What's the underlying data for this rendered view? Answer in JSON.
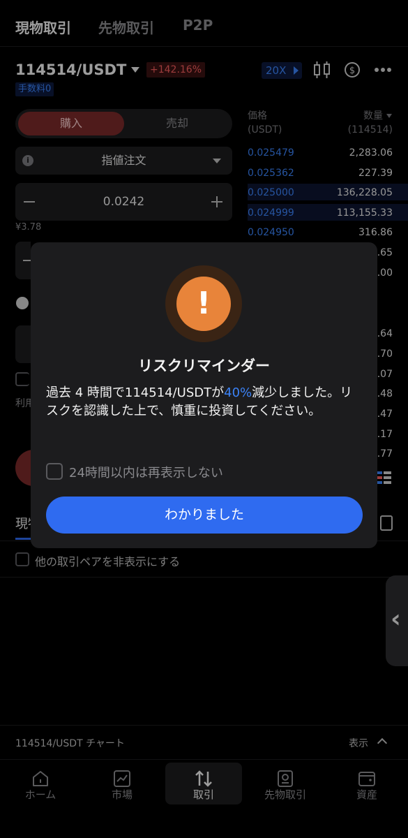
{
  "top_tabs": {
    "spot": "現物取引",
    "futures": "先物取引",
    "p2p": "P2P"
  },
  "pair": {
    "name": "114514/USDT",
    "change": "+142.16%",
    "fee_badge": "手数料0",
    "leverage": "20X"
  },
  "trade_form": {
    "buy_label": "購入",
    "sell_label": "売却",
    "order_type": "指値注文",
    "price_value": "0.0242",
    "yen_value": "¥3.78"
  },
  "order_book": {
    "price_header": "価格",
    "price_unit": "(USDT)",
    "qty_header": "数量",
    "qty_unit": "(114514)",
    "rows": [
      {
        "price": "0.025479",
        "qty": "2,283.06"
      },
      {
        "price": "0.025362",
        "qty": "227.39"
      },
      {
        "price": "0.025000",
        "qty": "136,228.05"
      },
      {
        "price": "0.024999",
        "qty": "113,155.33"
      },
      {
        "price": "0.024950",
        "qty": "316.86"
      }
    ],
    "residual_right": [
      ".65",
      ".00",
      ".64",
      ".70",
      ".07",
      ".48",
      ".47",
      ".17",
      ".77"
    ]
  },
  "background_text": {
    "partial_left_label": "利用",
    "positions_tab": "現物"
  },
  "modal": {
    "title": "リスクリマインダー",
    "body_pre": "過去 4 時間で114514/USDTが",
    "body_highlight": "40%",
    "body_post": "減少しました。リスクを認識した上で、慎重に投資してください。",
    "checkbox_label": "24時間以内は再表示しない",
    "ok_label": "わかりました",
    "warn_icon": "exclamation-icon"
  },
  "hide_pairs_label": "他の取引ペアを非表示にする",
  "chart_bar": {
    "label": "114514/USDT チャート",
    "show_label": "表示"
  },
  "bottom_nav": [
    {
      "label": "ホーム",
      "icon": "home-icon"
    },
    {
      "label": "市場",
      "icon": "chart-icon"
    },
    {
      "label": "取引",
      "icon": "trade-icon"
    },
    {
      "label": "先物取引",
      "icon": "futures-icon"
    },
    {
      "label": "資産",
      "icon": "wallet-icon"
    }
  ],
  "colors": {
    "accent_blue": "#2f6bf0",
    "up_red": "#f25c5c",
    "warning_orange": "#e8843a"
  }
}
